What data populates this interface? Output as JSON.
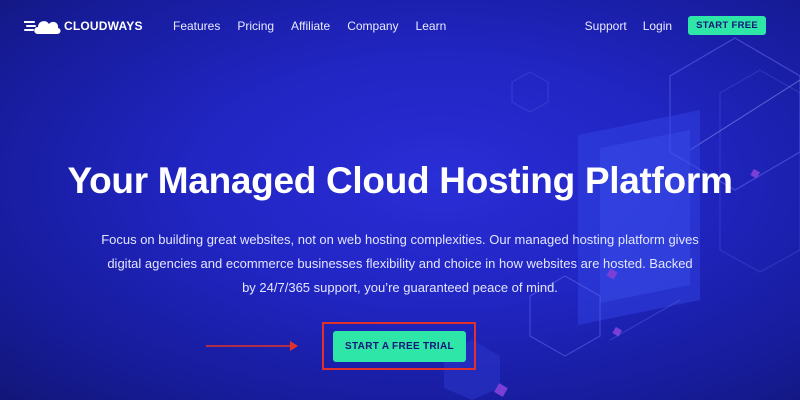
{
  "header": {
    "logo_text": "CLOUDWAYS",
    "logo_icon": "cloud-speed-icon",
    "nav": [
      {
        "label": "Features"
      },
      {
        "label": "Pricing"
      },
      {
        "label": "Affiliate"
      },
      {
        "label": "Company"
      },
      {
        "label": "Learn"
      }
    ],
    "support_label": "Support",
    "login_label": "Login",
    "start_free_label": "START FREE"
  },
  "hero": {
    "title": "Your Managed Cloud Hosting Platform",
    "subtitle_line1": "Focus on building great websites, not on web hosting complexities. Our managed hosting platform gives",
    "subtitle_line2": "digital agencies and ecommerce businesses flexibility and choice in how websites are hosted. Backed",
    "subtitle_line3": "by 24/7/365 support, you’re guaranteed peace of mind.",
    "cta_label": "START A FREE TRIAL"
  },
  "colors": {
    "background": "#2125c2",
    "accent": "#2ee6a8",
    "highlight_box": "#e0322b",
    "text": "#ffffff"
  }
}
